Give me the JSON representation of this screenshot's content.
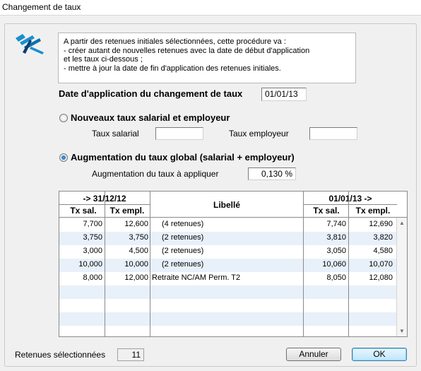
{
  "window": {
    "title": "Changement de taux"
  },
  "info": {
    "lines": [
      "A partir des retenues initiales sélectionnées, cette procédure va :",
      "- créer autant de nouvelles retenues avec la date de début d'application",
      "et les taux ci-dessous ;",
      "- mettre à jour la date de fin d'application des retenues initiales."
    ]
  },
  "date": {
    "label": "Date d'application du changement de taux",
    "value": "01/01/13"
  },
  "option_new": {
    "label": "Nouveaux taux salarial et employeur",
    "selected": false,
    "salarial_label": "Taux salarial",
    "salarial_value": "",
    "employeur_label": "Taux employeur",
    "employeur_value": ""
  },
  "option_increase": {
    "label": "Augmentation du taux global (salarial + employeur)",
    "selected": true,
    "rate_label": "Augmentation du taux à appliquer",
    "rate_value": "0,130 %"
  },
  "table": {
    "left_group": "-> 31/12/12",
    "right_group": "01/01/13 ->",
    "libelle": "Libellé",
    "tx_sal": "Tx sal.",
    "tx_empl": "Tx empl.",
    "rows": [
      {
        "old_sal": "7,700",
        "old_empl": "12,600",
        "libelle": "(4 retenues)",
        "new_sal": "7,740",
        "new_empl": "12,690"
      },
      {
        "old_sal": "3,750",
        "old_empl": "3,750",
        "libelle": "(2 retenues)",
        "new_sal": "3,810",
        "new_empl": "3,820"
      },
      {
        "old_sal": "3,000",
        "old_empl": "4,500",
        "libelle": "(2 retenues)",
        "new_sal": "3,050",
        "new_empl": "4,580"
      },
      {
        "old_sal": "10,000",
        "old_empl": "10,000",
        "libelle": "(2 retenues)",
        "new_sal": "10,060",
        "new_empl": "10,070"
      },
      {
        "old_sal": "8,000",
        "old_empl": "12,000",
        "libelle": "Retraite NC/AM Perm. T2",
        "new_sal": "8,050",
        "new_empl": "12,080"
      }
    ]
  },
  "footer": {
    "selected_label": "Retenues sélectionnées",
    "selected_count": "11",
    "cancel_label": "Annuler",
    "ok_label": "OK"
  },
  "colors": {
    "row_alt": "#e8f0fa",
    "logo_blue": "#1a8fd0",
    "default_button": "#3c7fb1"
  }
}
